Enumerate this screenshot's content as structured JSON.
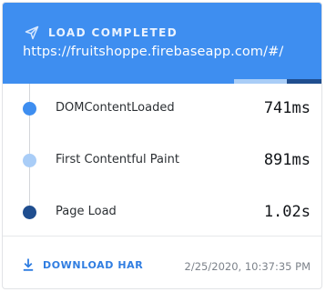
{
  "header": {
    "status_icon": "send-icon",
    "status_label": "LOAD COMPLETED",
    "url": "https://fruitshoppe.firebaseapp.com/#/",
    "colors": {
      "background": "#3e8ef0",
      "text": "#ffffff"
    }
  },
  "progress": {
    "segments": [
      {
        "metric": "DOMContentLoaded",
        "color": "#3e8ef0"
      },
      {
        "metric": "First Contentful Paint",
        "color": "#a9cdf7"
      },
      {
        "metric": "Page Load",
        "color": "#1f4e8f"
      }
    ]
  },
  "metrics": [
    {
      "label": "DOMContentLoaded",
      "value": "741ms",
      "color": "#3e8ef0"
    },
    {
      "label": "First Contentful Paint",
      "value": "891ms",
      "color": "#a9cdf7"
    },
    {
      "label": "Page Load",
      "value": "1.02s",
      "color": "#1f4e8f"
    }
  ],
  "footer": {
    "download_icon": "download-icon",
    "download_label": "DOWNLOAD HAR",
    "timestamp": "2/25/2020, 10:37:35 PM",
    "accent": "#2f7de1"
  }
}
